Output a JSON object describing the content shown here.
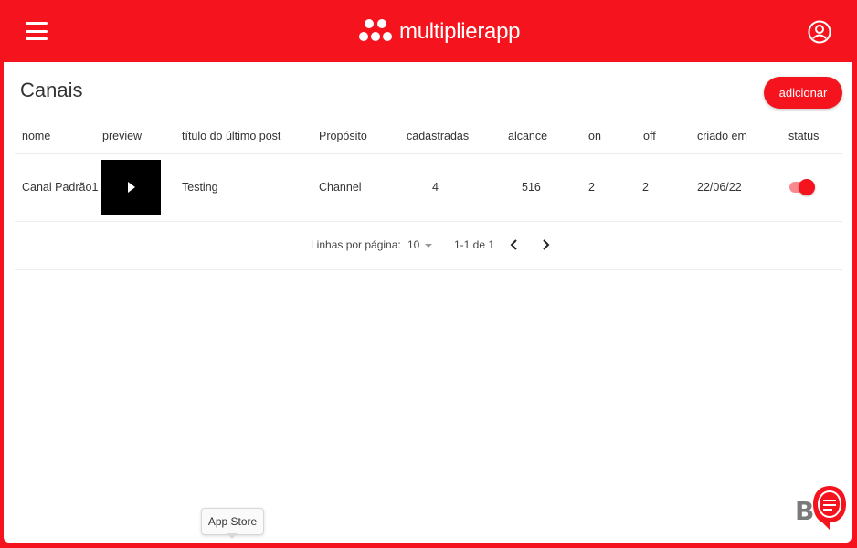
{
  "header": {
    "logo_text": "multiplierapp",
    "brand_color": "#f5141e",
    "menu_icon": "hamburger-menu-icon",
    "account_icon": "user-circle-icon"
  },
  "page": {
    "title": "Canais",
    "add_label": "adicionar"
  },
  "table": {
    "columns": [
      "nome",
      "preview",
      "título do último post",
      "Propósito",
      "cadastradas",
      "alcance",
      "on",
      "off",
      "criado em",
      "status"
    ],
    "rows": [
      {
        "nome": "Canal Padrão1",
        "titulo": "Testing",
        "proposito": "Channel",
        "cadastradas": "4",
        "alcance": "516",
        "on": "2",
        "off": "2",
        "criado_em": "22/06/22",
        "status_on": true
      }
    ]
  },
  "pagination": {
    "rows_label": "Linhas por página:",
    "rows_value": "10",
    "range": "1-1 de 1"
  },
  "tooltip": {
    "text": "App Store"
  }
}
